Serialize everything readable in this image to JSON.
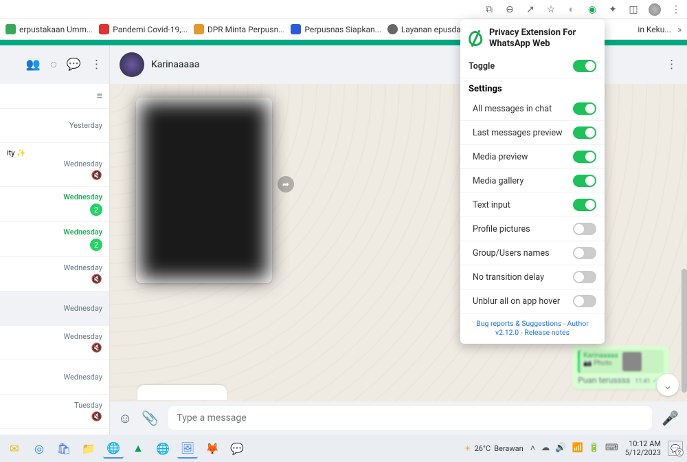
{
  "chrome": {
    "bookmarks": [
      {
        "label": "erpustakaan Umm...",
        "color": "#3aa757"
      },
      {
        "label": "Pandemi Covid-19,...",
        "color": "#d33"
      },
      {
        "label": "DPR Minta Perpusn...",
        "color": "#e09a2f"
      },
      {
        "label": "Perpusnas Siapkan...",
        "color": "#2b5bd7"
      },
      {
        "label": "Layanan epusdagu...",
        "color": "#666"
      }
    ],
    "bookmark_tail": "in Keku...",
    "more": "»"
  },
  "whatsapp": {
    "chat_name": "Karinaaaaa",
    "sidebar_partial": "ity ✨",
    "input_placeholder": "Type a message",
    "chats": [
      {
        "ts": "Yesterday",
        "green": false,
        "badge": null,
        "mute": false,
        "partial": ""
      },
      {
        "ts": "Wednesday",
        "green": false,
        "badge": null,
        "mute": true,
        "partial": "ity ✨"
      },
      {
        "ts": "Wednesday",
        "green": true,
        "badge": "2",
        "mute": false
      },
      {
        "ts": "Wednesday",
        "green": true,
        "badge": "2",
        "mute": false
      },
      {
        "ts": "Wednesday",
        "green": false,
        "badge": null,
        "mute": true
      },
      {
        "ts": "Wednesday",
        "green": false,
        "badge": null,
        "mute": false,
        "active": true
      },
      {
        "ts": "Wednesday",
        "green": false,
        "badge": null,
        "mute": true
      },
      {
        "ts": "Wednesday",
        "green": false,
        "badge": null,
        "mute": false
      },
      {
        "ts": "Tuesday",
        "green": false,
        "badge": null,
        "mute": true
      }
    ],
    "reply": {
      "quoted_name": "Karinaaaaa",
      "quoted_sub": "📷 Photo",
      "text": "Puan terussss",
      "time": "11:41"
    }
  },
  "extension": {
    "title": "Privacy Extension For WhatsApp Web",
    "toggle_label": "Toggle",
    "settings_label": "Settings",
    "items": [
      {
        "label": "All messages in chat",
        "on": true
      },
      {
        "label": "Last messages preview",
        "on": true
      },
      {
        "label": "Media preview",
        "on": true
      },
      {
        "label": "Media gallery",
        "on": true
      },
      {
        "label": "Text input",
        "on": true
      },
      {
        "label": "Profile pictures",
        "on": false
      },
      {
        "label": "Group/Users names",
        "on": false
      },
      {
        "label": "No transition delay",
        "on": false
      },
      {
        "label": "Unblur all on app hover",
        "on": false
      }
    ],
    "footer": {
      "bugs": "Bug reports & Suggestions",
      "author": "Author",
      "version": "v2.12.0",
      "release": "Release notes"
    }
  },
  "taskbar": {
    "weather": {
      "temp": "26°C",
      "cond": "Berawan"
    },
    "time": "10:12 AM",
    "date": "5/12/2023",
    "notif_count": "2"
  }
}
